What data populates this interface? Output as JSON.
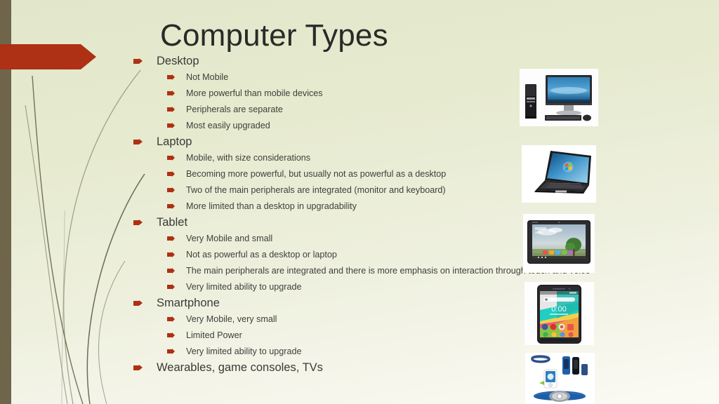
{
  "slide": {
    "title": "Computer Types",
    "background_color": "#e3e8cd",
    "accent_color": "#ae3015",
    "stripe_color": "#6e654b",
    "text_color": "#3a3a36"
  },
  "decor": {
    "arrow_banner_name": "red-arrow-banner",
    "left_stripe_name": "left-olive-stripe",
    "grass_lines_name": "grass-curves"
  },
  "outline": [
    {
      "label": "Desktop",
      "children": [
        "Not Mobile",
        "More powerful than mobile devices",
        "Peripherals are separate",
        "Most easily upgraded"
      ]
    },
    {
      "label": "Laptop",
      "children": [
        "Mobile, with size considerations",
        "Becoming more powerful, but usually not as powerful as a desktop",
        "Two of the main peripherals are integrated (monitor and keyboard)",
        "More limited than a desktop in upgradability"
      ]
    },
    {
      "label": "Tablet",
      "children": [
        "Very Mobile and small",
        "Not as powerful as a desktop or laptop",
        "The main peripherals are integrated and there is more emphasis on interaction through touch and voice",
        "Very limited ability to upgrade"
      ]
    },
    {
      "label": "Smartphone",
      "children": [
        "Very Mobile, very small",
        "Limited Power",
        "Very limited ability to upgrade"
      ]
    },
    {
      "label": "Wearables, game consoles, TVs",
      "children": []
    }
  ],
  "images": [
    {
      "name": "desktop-computer-photo",
      "alt": "Desktop computer with tower, monitor, keyboard and mouse"
    },
    {
      "name": "laptop-photo",
      "alt": "Black laptop showing Windows desktop"
    },
    {
      "name": "tablet-photo",
      "alt": "Android tablet showing landscape wallpaper with a tree"
    },
    {
      "name": "smartphone-photo",
      "alt": "Smartphone with colorful geometric wallpaper and app icons"
    },
    {
      "name": "wearables-photo",
      "alt": "Collage of wearable fitness bands, media player and chest strap"
    }
  ]
}
